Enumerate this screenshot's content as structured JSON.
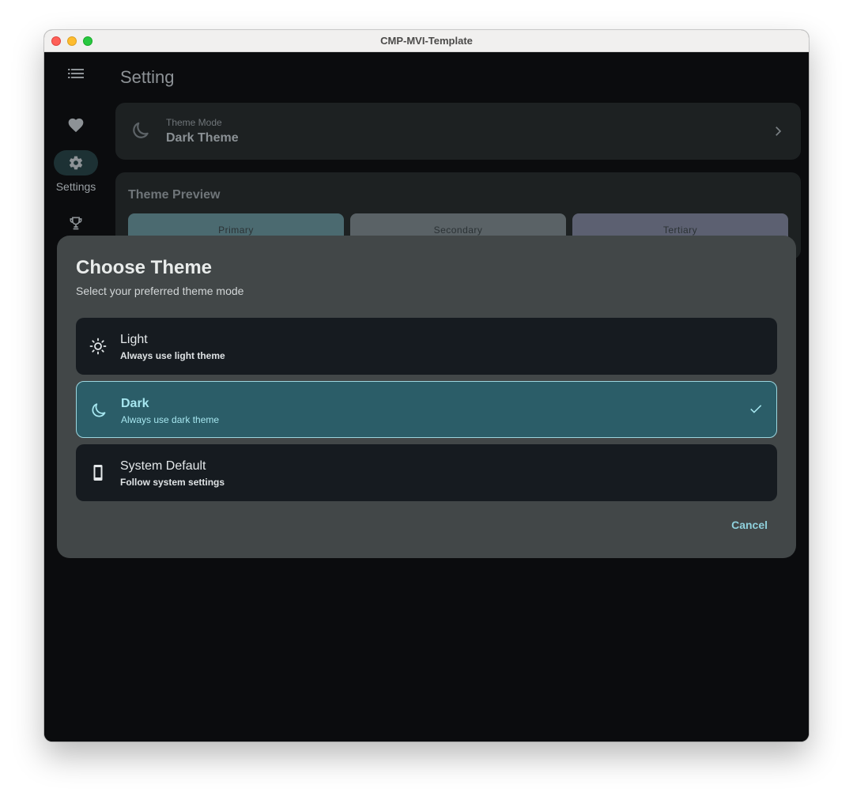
{
  "window": {
    "title": "CMP-MVI-Template"
  },
  "rail": {
    "items": [
      {
        "icon": "list-icon",
        "label": ""
      },
      {
        "icon": "heart-icon",
        "label": ""
      },
      {
        "icon": "gear-icon",
        "label": "Settings",
        "selected": true
      },
      {
        "icon": "trophy-icon",
        "label": ""
      }
    ]
  },
  "page": {
    "title": "Setting",
    "theme_mode": {
      "label": "Theme Mode",
      "value": "Dark Theme"
    },
    "preview": {
      "header": "Theme Preview",
      "swatches": [
        "Primary",
        "Secondary",
        "Tertiary"
      ]
    }
  },
  "dialog": {
    "title": "Choose Theme",
    "subtitle": "Select your preferred theme mode",
    "options": [
      {
        "icon": "sun-icon",
        "name": "Light",
        "desc": "Always use light theme",
        "selected": false
      },
      {
        "icon": "moon-icon",
        "name": "Dark",
        "desc": "Always use dark theme",
        "selected": true
      },
      {
        "icon": "phone-icon",
        "name": "System Default",
        "desc": "Follow system settings",
        "selected": false
      }
    ],
    "cancel_label": "Cancel"
  },
  "colors": {
    "accent": "#8fd0dc",
    "selected_bg": "#2b5d68",
    "dialog_bg": "#424748"
  }
}
